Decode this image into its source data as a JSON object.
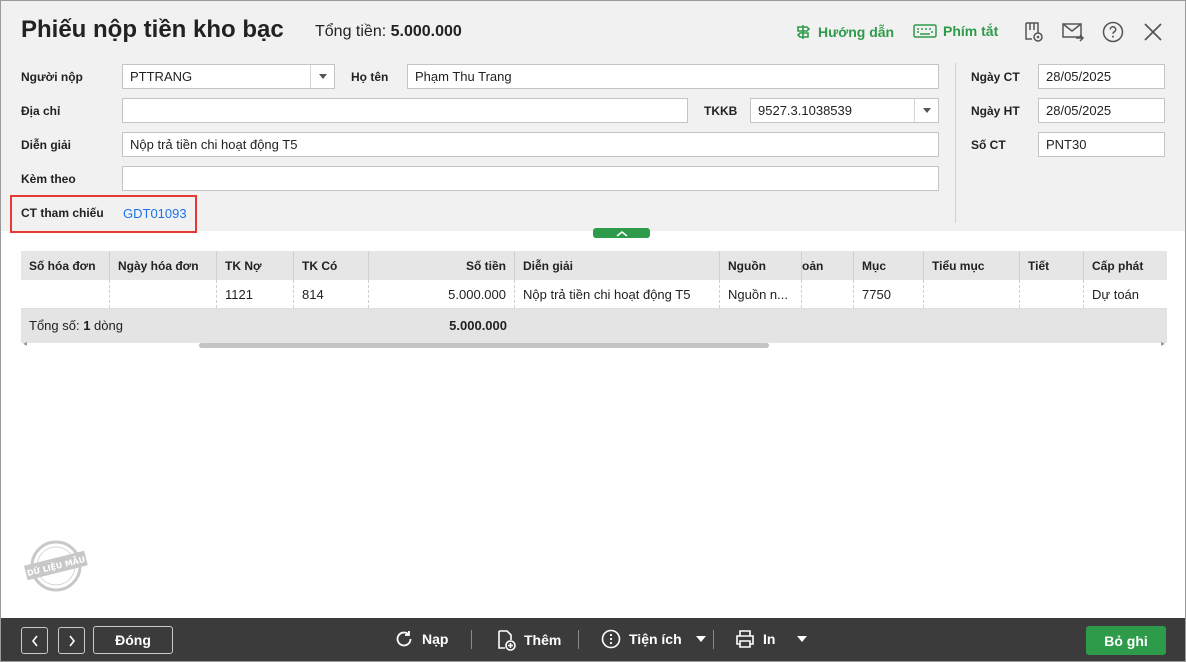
{
  "window": {
    "title": "Phiếu nộp tiền kho bạc",
    "total_label": "Tổng tiền:",
    "total_value": "5.000.000"
  },
  "toolbar": {
    "guide_label": "Hướng dẫn",
    "shortcuts_label": "Phím tắt"
  },
  "form": {
    "payer_label": "Người nộp",
    "payer_value": "PTTRANG",
    "fullname_label": "Họ tên",
    "fullname_value": "Phạm Thu Trang",
    "address_label": "Địa chỉ",
    "address_value": "",
    "tkkb_label": "TKKB",
    "tkkb_value": "9527.3.1038539",
    "description_label": "Diễn giải",
    "description_value": "Nộp trả tiền chi hoạt động T5",
    "attachment_label": "Kèm theo",
    "attachment_value": "",
    "reference_label": "CT tham chiếu",
    "reference_value": "GDT01093",
    "doc_date_label": "Ngày CT",
    "doc_date_value": "28/05/2025",
    "post_date_label": "Ngày HT",
    "post_date_value": "28/05/2025",
    "doc_no_label": "Số CT",
    "doc_no_value": "PNT30"
  },
  "grid": {
    "columns": [
      "Số hóa đơn",
      "Ngày hóa đơn",
      "TK Nợ",
      "TK Có",
      "Số tiền",
      "Diễn giải",
      "Nguồn",
      "oản",
      "Mục",
      "Tiểu mục",
      "Tiết",
      "Cấp phát"
    ],
    "rows": [
      [
        "",
        "",
        "1121",
        "814",
        "5.000.000",
        "Nộp trả tiền chi hoạt động T5",
        "Nguồn n...",
        "",
        "7750",
        "",
        "",
        "Dự toán"
      ]
    ],
    "footer_prefix": "Tổng số: ",
    "footer_count": "1",
    "footer_suffix": " dòng",
    "footer_total": "5.000.000"
  },
  "watermark": {
    "text": "DỮ LIỆU MẪU"
  },
  "footer": {
    "close_label": "Đóng",
    "reload_label": "Nạp",
    "add_label": "Thêm",
    "utilities_label": "Tiện ích",
    "print_label": "In",
    "cancel_label": "Bỏ ghi"
  },
  "colors": {
    "accent_green": "#2e9b4b",
    "link_blue": "#1a73e8",
    "highlight_red": "#e53935"
  }
}
